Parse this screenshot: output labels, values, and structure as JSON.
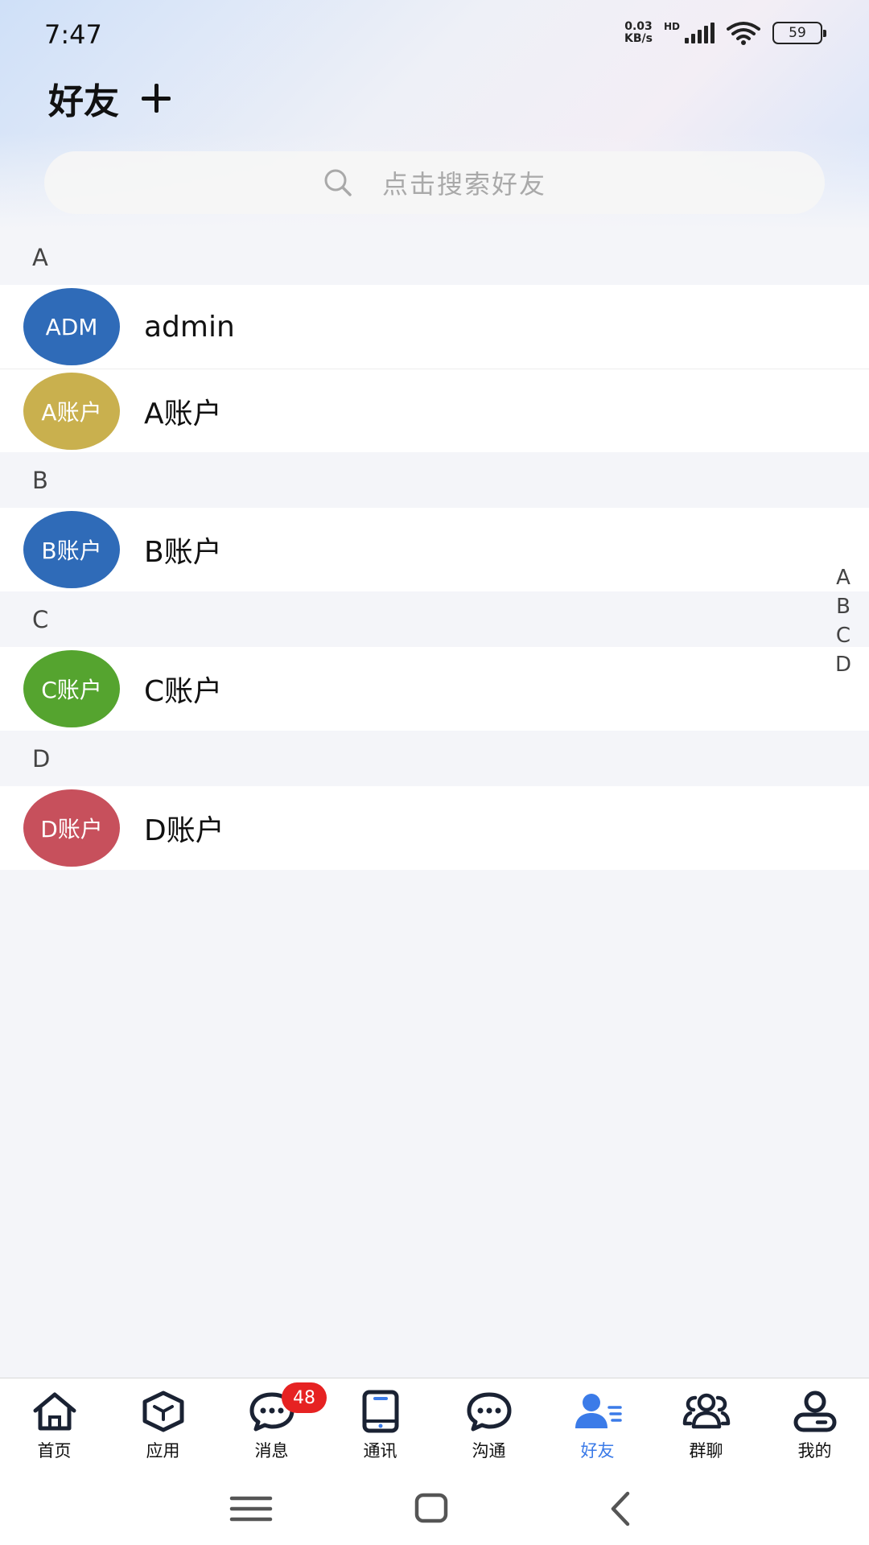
{
  "status_bar": {
    "time": "7:47",
    "net_speed_value": "0.03",
    "net_speed_unit": "KB/s",
    "hd_label": "HD",
    "battery": "59"
  },
  "header": {
    "title": "好友",
    "search_placeholder": "点击搜索好友"
  },
  "sections": [
    {
      "letter": "A",
      "contacts": [
        {
          "avatar_text": "ADM",
          "name": "admin",
          "color": "#2f6bb8"
        },
        {
          "avatar_text": "A账户",
          "name": "A账户",
          "color": "#c9b04e"
        }
      ]
    },
    {
      "letter": "B",
      "contacts": [
        {
          "avatar_text": "B账户",
          "name": "B账户",
          "color": "#2f6bb8"
        }
      ]
    },
    {
      "letter": "C",
      "contacts": [
        {
          "avatar_text": "C账户",
          "name": "C账户",
          "color": "#55a42f"
        }
      ]
    },
    {
      "letter": "D",
      "contacts": [
        {
          "avatar_text": "D账户",
          "name": "D账户",
          "color": "#c7505c"
        }
      ]
    }
  ],
  "index_letters": [
    "A",
    "B",
    "C",
    "D"
  ],
  "tabbar": {
    "active_color": "#3b7be8",
    "items": [
      {
        "label": "首页",
        "icon": "home-icon"
      },
      {
        "label": "应用",
        "icon": "cube-icon"
      },
      {
        "label": "消息",
        "icon": "message-icon",
        "badge": "48"
      },
      {
        "label": "通讯",
        "icon": "phone-icon"
      },
      {
        "label": "沟通",
        "icon": "chat-icon"
      },
      {
        "label": "好友",
        "icon": "friends-icon",
        "active": true
      },
      {
        "label": "群聊",
        "icon": "group-icon"
      },
      {
        "label": "我的",
        "icon": "profile-icon"
      }
    ]
  },
  "system_nav": {
    "icons": [
      "menu-icon",
      "home-square-icon",
      "back-icon"
    ]
  }
}
